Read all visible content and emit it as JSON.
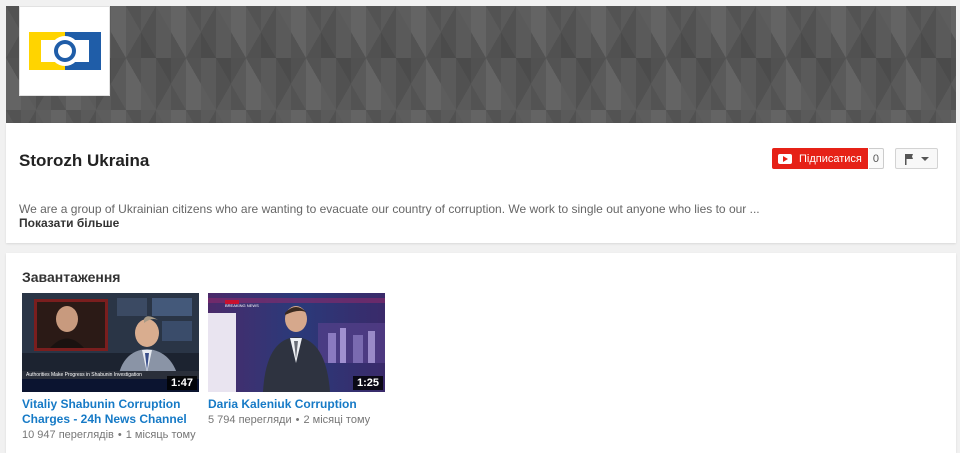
{
  "channel": {
    "title": "Storozh Ukraina",
    "description": "We are a group of Ukrainian citizens who are wanting to evacuate our country of corruption. We work to single out anyone who lies to our ...",
    "show_more": "Показати більше",
    "subscribe_label": "Підписатися",
    "subscriber_count": "0",
    "avatar_icon": "eye-logo-icon",
    "banner_icon": "triangle-pattern"
  },
  "uploads": {
    "title": "Завантаження",
    "videos": [
      {
        "title": "Vitaliy Shabunin Corruption Charges - 24h News Channel",
        "views": "10 947 переглядів",
        "age": "1 місяць тому",
        "duration": "1:47",
        "ticker": "Authorities Make Progress in Shabunin Investigation"
      },
      {
        "title": "Daria Kaleniuk Corruption",
        "views": "5 794 перегляди",
        "age": "2 місяці тому",
        "duration": "1:25",
        "ticker": "BREAKING NEWS"
      }
    ]
  },
  "colors": {
    "subscribe_red": "#e62117",
    "link_blue": "#167ac6",
    "logo_yellow": "#ffd400",
    "logo_blue": "#1f5da8"
  }
}
